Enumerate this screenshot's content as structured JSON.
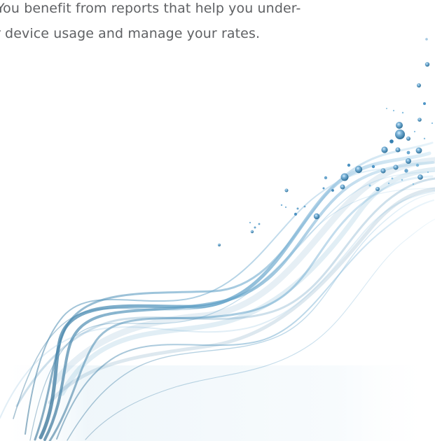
{
  "text": {
    "line1": "You benefit from reports that help you under-",
    "line2": "r device usage and manage your rates."
  },
  "art": {
    "primary_color": "#4f8fb7",
    "secondary_color": "#9bc6e2",
    "dark_color": "#2d6f98",
    "floor_color": "#e7f2f8"
  }
}
